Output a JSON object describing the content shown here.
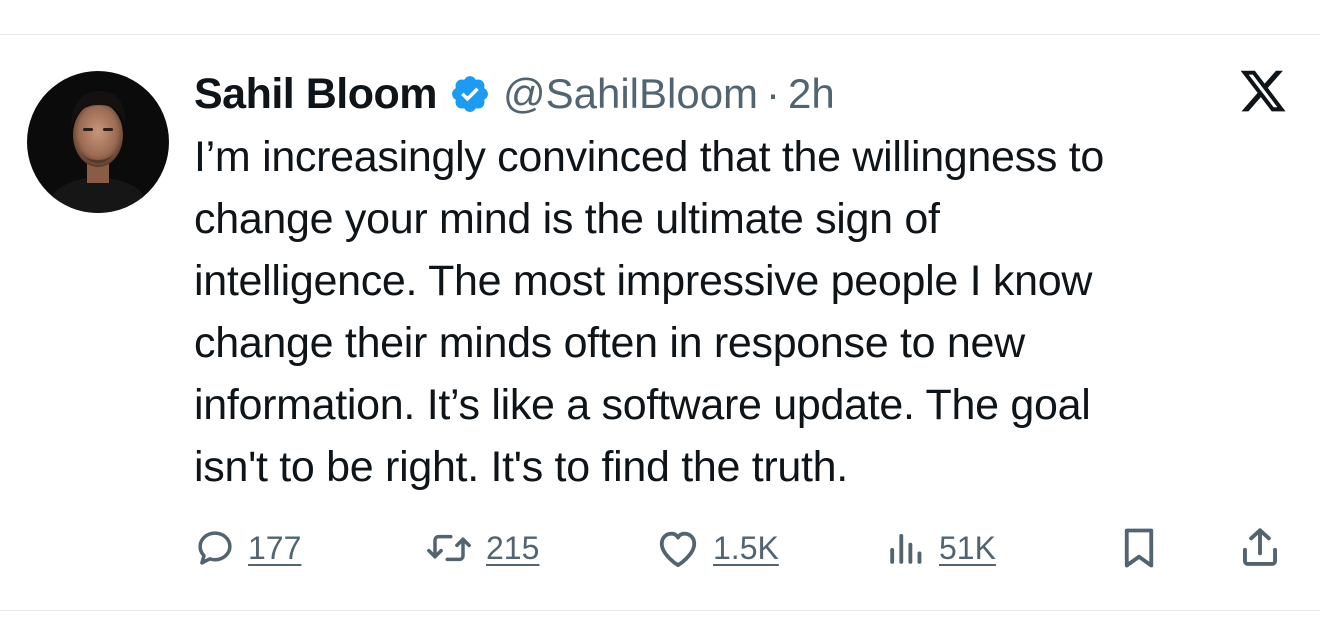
{
  "tweet": {
    "author_name": "Sahil Bloom",
    "handle": "@SahilBloom",
    "separator": "·",
    "time": "2h",
    "text": "I’m increasingly convinced that the willingness to\nchange your mind is the ultimate sign of\nintelligence. The most impressive people I know\nchange their minds often in response to new\ninformation. It’s like a software update. The goal\nisn't to be right. It's to find the truth."
  },
  "actions": {
    "replies": "177",
    "retweets": "215",
    "likes": "1.5K",
    "views": "51K"
  },
  "icons": {
    "verified": "verified-badge-icon",
    "platform": "x-logo-icon",
    "reply": "reply-icon",
    "retweet": "retweet-icon",
    "like": "heart-icon",
    "views": "views-icon",
    "bookmark": "bookmark-icon",
    "share": "share-icon"
  },
  "colors": {
    "text": "#0f1419",
    "secondary": "#536471",
    "verified": "#1d9bf0",
    "divider": "#e6e9ec"
  }
}
